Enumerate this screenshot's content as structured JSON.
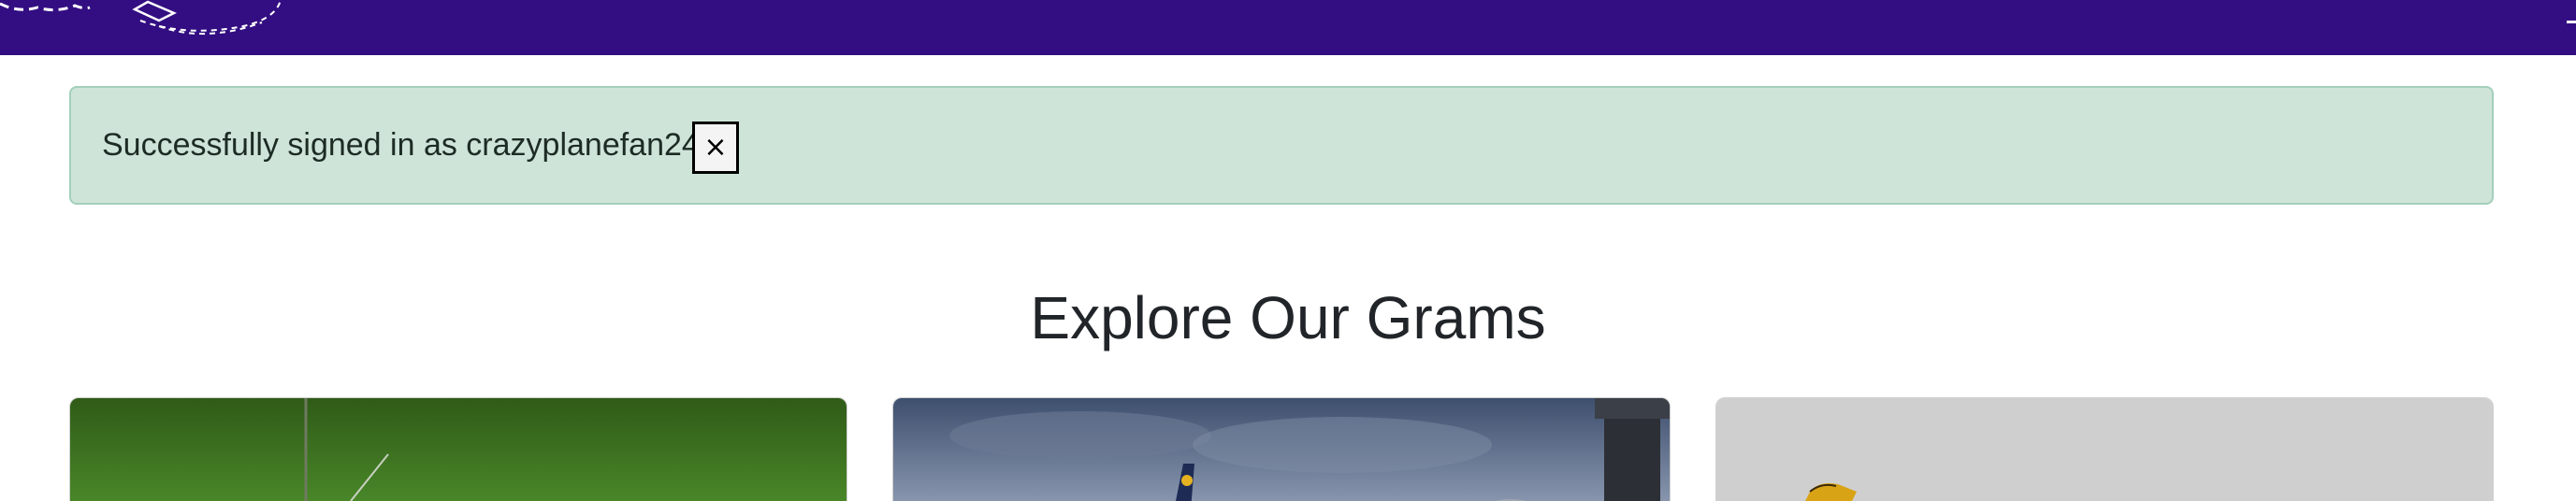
{
  "alert": {
    "message": "Successfully signed in as crazyplanefan24.",
    "close_label": "×"
  },
  "page": {
    "heading": "Explore Our Grams"
  },
  "colors": {
    "navbar": "#330e82",
    "alert_background": "#cfe4d9",
    "alert_border": "#a3cfbb"
  },
  "icons": {
    "brand_logo": "airplane-logo",
    "close": "close-icon"
  },
  "gallery": {
    "cards": [
      {
        "image": "aircraft on green field"
      },
      {
        "image": "airliner under cloudy sky with control tower"
      },
      {
        "image": "aircraft tail on light grey background"
      }
    ]
  }
}
